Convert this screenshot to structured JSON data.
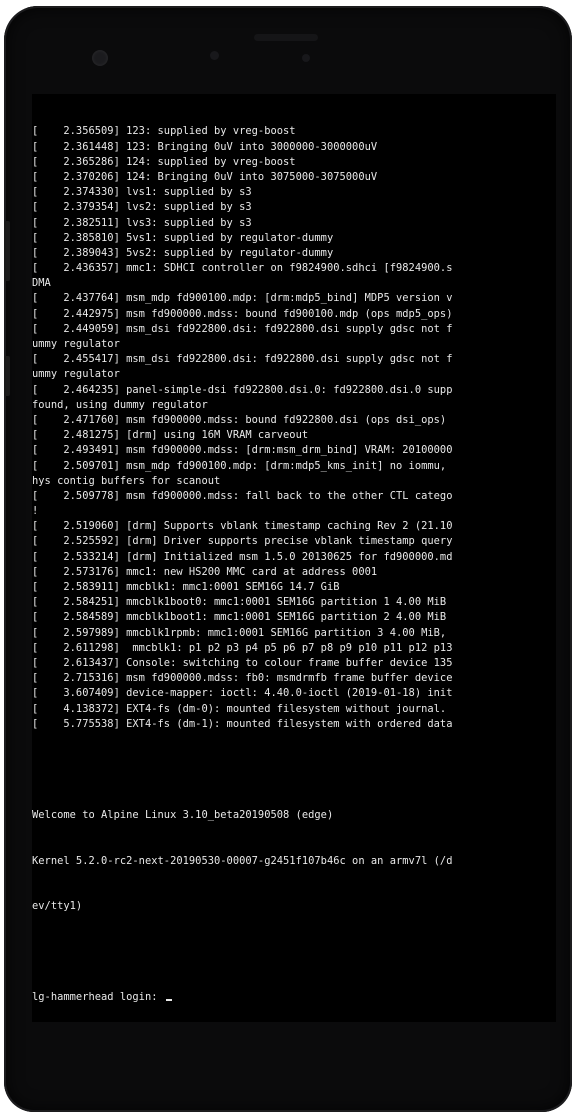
{
  "console": {
    "kernel_lines": [
      "[    2.356509] 123: supplied by vreg-boost",
      "[    2.361448] 123: Bringing 0uV into 3000000-3000000uV",
      "[    2.365286] 124: supplied by vreg-boost",
      "[    2.370206] 124: Bringing 0uV into 3075000-3075000uV",
      "[    2.374330] lvs1: supplied by s3",
      "[    2.379354] lvs2: supplied by s3",
      "[    2.382511] lvs3: supplied by s3",
      "[    2.385810] 5vs1: supplied by regulator-dummy",
      "[    2.389043] 5vs2: supplied by regulator-dummy",
      "[    2.436357] mmc1: SDHCI controller on f9824900.sdhci [f9824900.s",
      "DMA",
      "[    2.437764] msm_mdp fd900100.mdp: [drm:mdp5_bind] MDP5 version v",
      "[    2.442975] msm fd900000.mdss: bound fd900100.mdp (ops mdp5_ops)",
      "[    2.449059] msm_dsi fd922800.dsi: fd922800.dsi supply gdsc not f",
      "ummy regulator",
      "[    2.455417] msm_dsi fd922800.dsi: fd922800.dsi supply gdsc not f",
      "ummy regulator",
      "[    2.464235] panel-simple-dsi fd922800.dsi.0: fd922800.dsi.0 supp",
      "found, using dummy regulator",
      "[    2.471760] msm fd900000.mdss: bound fd922800.dsi (ops dsi_ops)",
      "[    2.481275] [drm] using 16M VRAM carveout",
      "[    2.493491] msm fd900000.mdss: [drm:msm_drm_bind] VRAM: 20100000",
      "[    2.509701] msm_mdp fd900100.mdp: [drm:mdp5_kms_init] no iommu,",
      "hys contig buffers for scanout",
      "[    2.509778] msm fd900000.mdss: fall back to the other CTL catego",
      "!",
      "[    2.519060] [drm] Supports vblank timestamp caching Rev 2 (21.10",
      "[    2.525592] [drm] Driver supports precise vblank timestamp query",
      "[    2.533214] [drm] Initialized msm 1.5.0 20130625 for fd900000.md",
      "[    2.573176] mmc1: new HS200 MMC card at address 0001",
      "[    2.583911] mmcblk1: mmc1:0001 SEM16G 14.7 GiB",
      "[    2.584251] mmcblk1boot0: mmc1:0001 SEM16G partition 1 4.00 MiB",
      "[    2.584589] mmcblk1boot1: mmc1:0001 SEM16G partition 2 4.00 MiB",
      "[    2.597989] mmcblk1rpmb: mmc1:0001 SEM16G partition 3 4.00 MiB,",
      "[    2.611298]  mmcblk1: p1 p2 p3 p4 p5 p6 p7 p8 p9 p10 p11 p12 p13",
      "[    2.613437] Console: switching to colour frame buffer device 135",
      "[    2.715316] msm fd900000.mdss: fb0: msmdrmfb frame buffer device",
      "[    3.607409] device-mapper: ioctl: 4.40.0-ioctl (2019-01-18) init",
      "[    4.138372] EXT4-fs (dm-0): mounted filesystem without journal.",
      "[    5.775538] EXT4-fs (dm-1): mounted filesystem with ordered data"
    ],
    "welcome_line": "Welcome to Alpine Linux 3.10_beta20190508 (edge)",
    "kernel_version_line_1": "Kernel 5.2.0-rc2-next-20190530-00007-g2451f107b46c on an armv7l (/d",
    "kernel_version_line_2": "ev/tty1)",
    "login_prompt": "lg-hammerhead login: "
  },
  "colors": {
    "screen_bg": "#000000",
    "text": "#e9e9e9",
    "device_body": "#0b0b0c"
  }
}
